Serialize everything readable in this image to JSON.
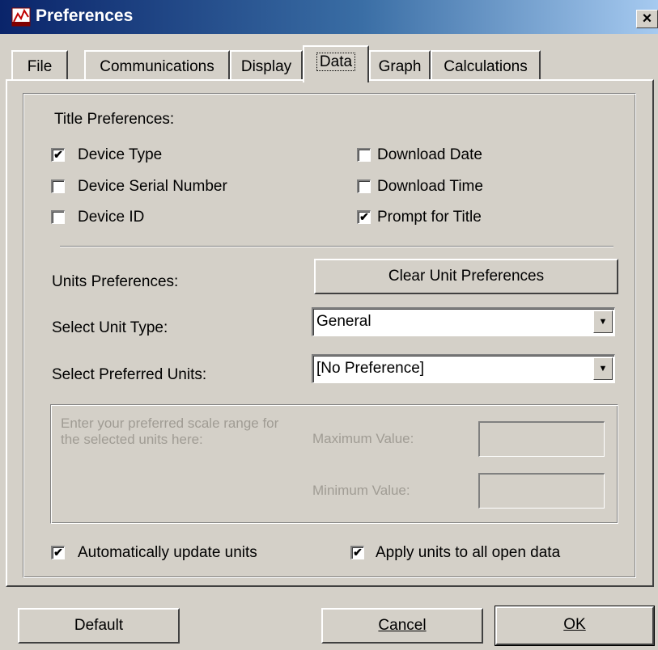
{
  "window": {
    "title": "Preferences",
    "close_label": "×"
  },
  "tabs": [
    {
      "label": "File"
    },
    {
      "label": "Communications"
    },
    {
      "label": "Display"
    },
    {
      "label": "Data"
    },
    {
      "label": "Graph"
    },
    {
      "label": "Calculations"
    }
  ],
  "title_prefs": {
    "heading": "Title Preferences:",
    "device_type": {
      "label": "Device Type",
      "checked": true
    },
    "device_serial": {
      "label": "Device Serial Number",
      "checked": false
    },
    "device_id": {
      "label": "Device ID",
      "checked": false
    },
    "download_date": {
      "label": "Download Date",
      "checked": false
    },
    "download_time": {
      "label": "Download Time",
      "checked": false
    },
    "prompt_title": {
      "label": "Prompt for Title",
      "checked": true
    }
  },
  "units": {
    "heading": "Units Preferences:",
    "clear_button": "Clear Unit Preferences",
    "unit_type_label": "Select Unit Type:",
    "unit_type_value": "General",
    "preferred_label": "Select Preferred Units:",
    "preferred_value": "[No Preference]"
  },
  "scale": {
    "instruction": "Enter your preferred scale range for the selected units here:",
    "max_label": "Maximum Value:",
    "min_label": "Minimum Value:",
    "max_value": "",
    "min_value": ""
  },
  "options": {
    "auto_update": {
      "label": "Automatically update units",
      "checked": true
    },
    "apply_all": {
      "label": "Apply units to all open data",
      "checked": true
    }
  },
  "footer": {
    "default_button": "Default",
    "cancel_button": "Cancel",
    "ok_button": "OK"
  },
  "check_glyph": "✔"
}
